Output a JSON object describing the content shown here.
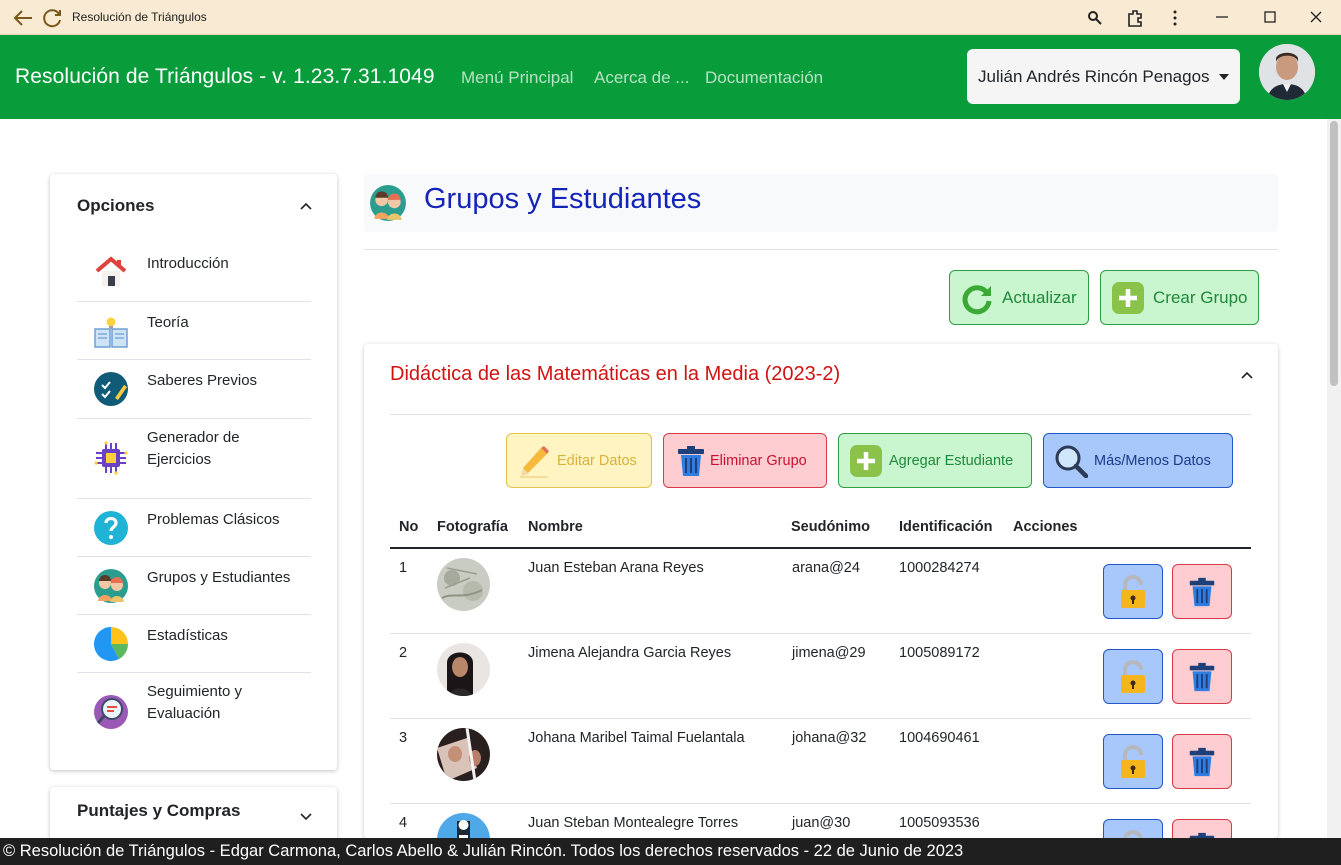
{
  "window": {
    "title": "Resolución de Triángulos"
  },
  "navbar": {
    "brand": "Resolución de Triángulos - v. 1.23.7.31.1049",
    "links": [
      "Menú Principal",
      "Acerca de ...",
      "Documentación"
    ],
    "user_name": "Julián Andrés Rincón Penagos"
  },
  "sidebar": {
    "heading": "Opciones",
    "items": [
      {
        "label": "Introducción",
        "icon": "house-icon"
      },
      {
        "label": "Teoría",
        "icon": "book-lightbulb-icon"
      },
      {
        "label": "Saberes Previos",
        "icon": "checklist-pencil-icon"
      },
      {
        "label": "Generador de Ejercicios",
        "icon": "chip-icon"
      },
      {
        "label": "Problemas Clásicos",
        "icon": "question-icon"
      },
      {
        "label": "Grupos y Estudiantes",
        "icon": "students-icon"
      },
      {
        "label": "Estadísticas",
        "icon": "pie-chart-icon"
      },
      {
        "label": "Seguimiento y Evaluación",
        "icon": "evaluation-icon"
      }
    ],
    "second_heading": "Puntajes y Compras"
  },
  "page": {
    "title": "Grupos y Estudiantes",
    "refresh_label": "Actualizar",
    "create_group_label": "Crear Grupo"
  },
  "group": {
    "title": "Didáctica de las Matemáticas en la Media (2023-2)",
    "edit_label": "Editar Datos",
    "delete_label": "Eliminar Grupo",
    "add_student_label": "Agregar Estudiante",
    "more_less_label": "Más/Menos Datos",
    "columns": [
      "No",
      "Fotografía",
      "Nombre",
      "Seudónimo",
      "Identificación",
      "Acciones"
    ],
    "students": [
      {
        "no": "1",
        "name": "Juan Esteban Arana Reyes",
        "alias": "arana@24",
        "id": "1000284274"
      },
      {
        "no": "2",
        "name": "Jimena Alejandra Garcia Reyes",
        "alias": "jimena@29",
        "id": "1005089172"
      },
      {
        "no": "3",
        "name": "Johana Maribel Taimal Fuelantala",
        "alias": "johana@32",
        "id": "1004690461"
      },
      {
        "no": "4",
        "name": "Juan Steban Montealegre Torres",
        "alias": "juan@30",
        "id": "1005093536"
      }
    ]
  },
  "footer": {
    "text": "© Resolución de Triángulos - Edgar Carmona, Carlos Abello & Julián Rincón. Todos los derechos reservados - 22 de Junio de 2023"
  },
  "colors": {
    "navbar": "#089c3b",
    "title_blue": "#1424b8",
    "group_title_red": "#d11212"
  }
}
